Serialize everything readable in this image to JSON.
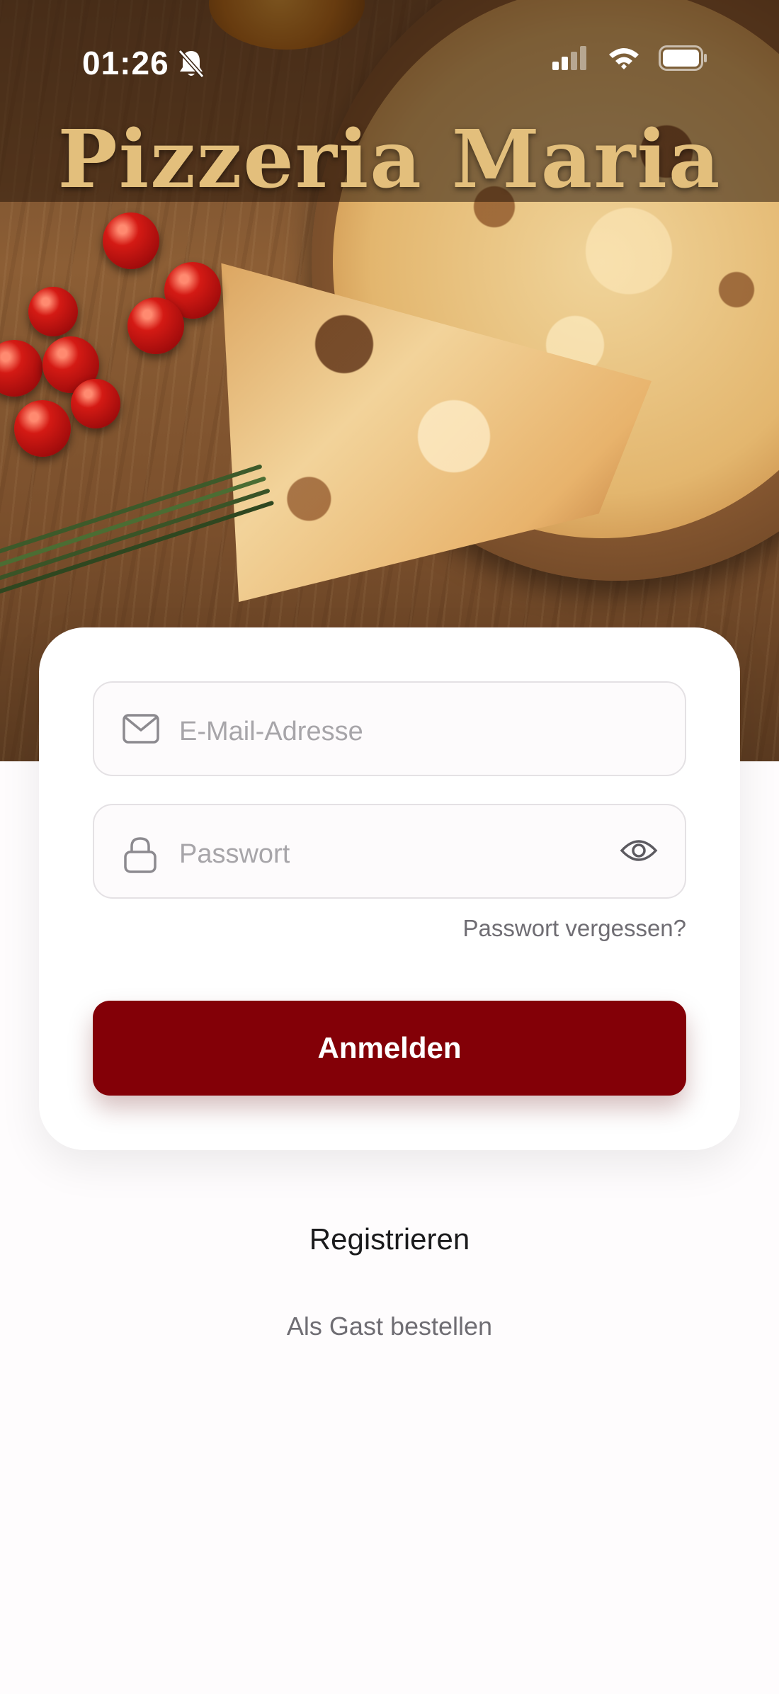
{
  "status_bar": {
    "time": "01:26",
    "icons": [
      "bell-muted-icon",
      "cellular-signal-icon",
      "wifi-icon",
      "battery-icon"
    ]
  },
  "header": {
    "title": "Pizzeria Maria"
  },
  "login": {
    "email_placeholder": "E-Mail-Adresse",
    "password_placeholder": "Passwort",
    "forgot_password": "Passwort vergessen?",
    "submit_label": "Anmelden"
  },
  "footer": {
    "register_label": "Registrieren",
    "guest_label": "Als Gast bestellen"
  },
  "colors": {
    "primary": "#830007",
    "title_gold": "#e3bf7c",
    "background": "#fefcfd"
  }
}
